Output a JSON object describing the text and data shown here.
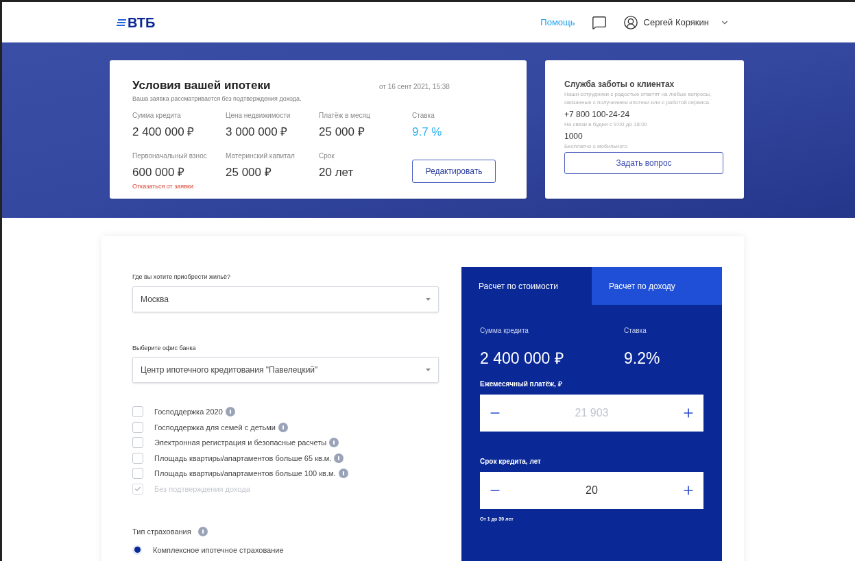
{
  "header": {
    "logo": "ВТБ",
    "help_link": "Помощь",
    "user_name": "Сергей Корякин"
  },
  "mortgage_card": {
    "title": "Условия вашей ипотеки",
    "date": "от 16 сент 2021, 15:38",
    "subtitle": "Ваша заявка рассматривается без подтверждения дохода.",
    "fields": [
      {
        "label": "Сумма кредита",
        "value": "2 400 000 ₽",
        "kind": "plain"
      },
      {
        "label": "Цена недвижимости",
        "value": "3 000 000 ₽",
        "kind": "plain"
      },
      {
        "label": "Платёж в месяц",
        "value": "25 000 ₽",
        "kind": "plain"
      },
      {
        "label": "Ставка",
        "value": "9.7 %",
        "kind": "accent"
      },
      {
        "label": "Первоначальный взнос",
        "value": "600 000 ₽",
        "kind": "plain"
      },
      {
        "label": "Материнский капитал",
        "value": "25 000 ₽",
        "kind": "plain"
      },
      {
        "label": "Срок",
        "value": "20 лет",
        "kind": "plain"
      }
    ],
    "cancel_link": "Отказаться от заявки",
    "edit_button": "Редактировать"
  },
  "support_card": {
    "title": "Служба заботы о клиентах",
    "description": "Наши сотрудники с радостью ответят на любые вопросы, связанные с получением ипотеки или с работой сервиса.",
    "phones": [
      {
        "number": "+7 800 100-24-24",
        "note": "На связи в будни с 9:00 до 18:00"
      },
      {
        "number": "1000",
        "note": "Бесплатно с мобильного"
      }
    ],
    "ask_button": "Задать вопрос"
  },
  "form": {
    "selects": [
      {
        "label": "Где вы хотите приобрести жильё?",
        "value": "Москва"
      },
      {
        "label": "Выберите офис банка",
        "value": "Центр ипотечного кредитования \"Павелецкий\""
      }
    ],
    "options": [
      {
        "label": "Господдержка 2020",
        "checked": false,
        "disabled": false
      },
      {
        "label": "Господдержка для семей с детьми",
        "checked": false,
        "disabled": false
      },
      {
        "label": "Электронная регистрация и безопасные расчеты",
        "checked": false,
        "disabled": false
      },
      {
        "label": "Площадь квартиры/апартаментов больше 65 кв.м.",
        "checked": false,
        "disabled": false
      },
      {
        "label": "Площадь квартиры/апартаментов больше 100 кв.м.",
        "checked": false,
        "disabled": false
      },
      {
        "label": "Без подтверждения дохода",
        "checked": true,
        "disabled": true
      }
    ],
    "insurance": {
      "label": "Тип страхования",
      "choices": [
        {
          "label": "Комплексное ипотечное страхование",
          "selected": true
        }
      ]
    }
  },
  "calculator": {
    "tabs": [
      {
        "label": "Расчет по стоимости",
        "selected": true
      },
      {
        "label": "Расчет по доходу",
        "selected": false
      }
    ],
    "summary": [
      {
        "label": "Сумма кредита",
        "value": "2 400 000 ₽"
      },
      {
        "label": "Ставка",
        "value": "9.2%"
      }
    ],
    "steppers": [
      {
        "label": "Ежемесячный платёж, ₽",
        "placeholder": "21 903"
      },
      {
        "label": "Срок кредита, лет",
        "value": "20",
        "hint": "От 1 до 30 лет"
      }
    ]
  }
}
